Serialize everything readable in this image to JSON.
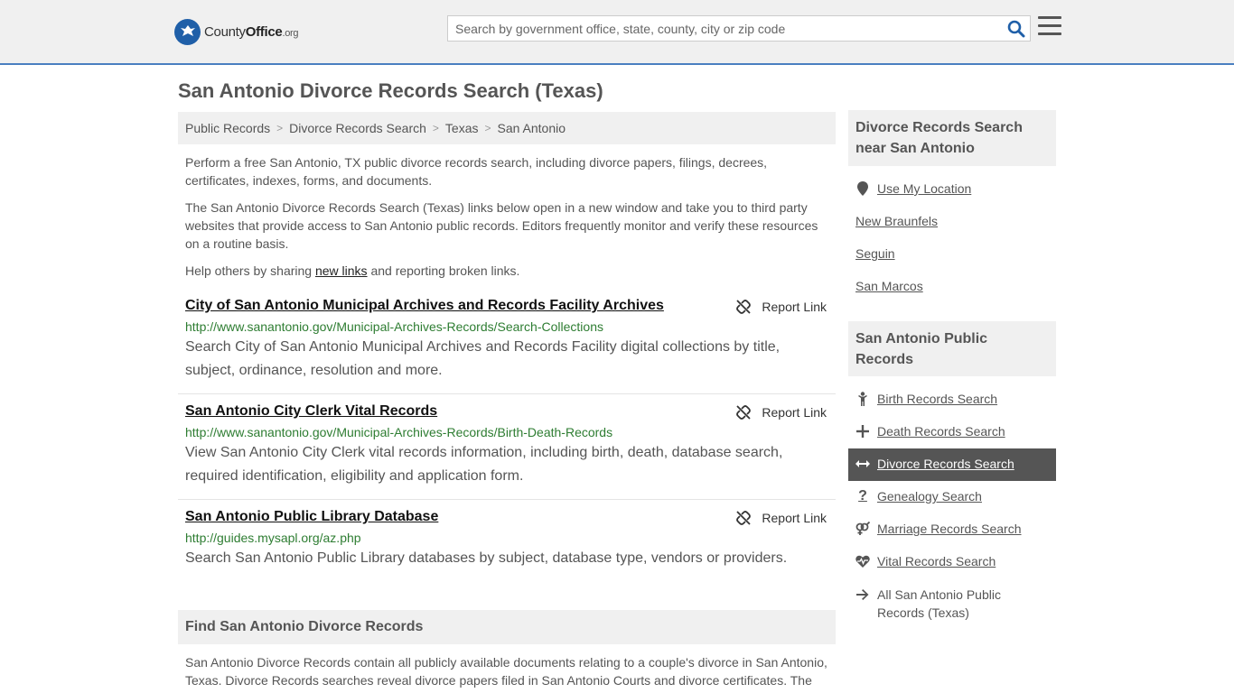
{
  "header": {
    "logo_main": "County",
    "logo_bold": "Office",
    "logo_suffix": ".org",
    "search_placeholder": "Search by government office, state, county, city or zip code"
  },
  "page_title": "San Antonio Divorce Records Search (Texas)",
  "breadcrumb": [
    "Public Records",
    "Divorce Records Search",
    "Texas",
    "San Antonio"
  ],
  "intro": {
    "p1": "Perform a free San Antonio, TX public divorce records search, including divorce papers, filings, decrees, certificates, indexes, forms, and documents.",
    "p2": "The San Antonio Divorce Records Search (Texas) links below open in a new window and take you to third party websites that provide access to San Antonio public records. Editors frequently monitor and verify these resources on a routine basis.",
    "p3_before": "Help others by sharing ",
    "p3_link": "new links",
    "p3_after": " and reporting broken links."
  },
  "report_label": "Report Link",
  "records": [
    {
      "title": "City of San Antonio Municipal Archives and Records Facility Archives",
      "url": "http://www.sanantonio.gov/Municipal-Archives-Records/Search-Collections",
      "desc": "Search City of San Antonio Municipal Archives and Records Facility digital collections by title, subject, ordinance, resolution and more."
    },
    {
      "title": "San Antonio City Clerk Vital Records",
      "url": "http://www.sanantonio.gov/Municipal-Archives-Records/Birth-Death-Records",
      "desc": "View San Antonio City Clerk vital records information, including birth, death, database search, required identification, eligibility and application form."
    },
    {
      "title": "San Antonio Public Library Database",
      "url": "http://guides.mysapl.org/az.php",
      "desc": "Search San Antonio Public Library databases by subject, database type, vendors or providers."
    }
  ],
  "find": {
    "heading": "Find San Antonio Divorce Records",
    "text": "San Antonio Divorce Records contain all publicly available documents relating to a couple's divorce in San Antonio, Texas. Divorce Records searches reveal divorce papers filed in San Antonio Courts and divorce certificates. The"
  },
  "sidebar": {
    "nearby_heading": "Divorce Records Search near San Antonio",
    "nearby": [
      "Use My Location",
      "New Braunfels",
      "Seguin",
      "San Marcos"
    ],
    "public_heading": "San Antonio Public Records",
    "public": [
      {
        "label": "Birth Records Search",
        "icon": "child-icon"
      },
      {
        "label": "Death Records Search",
        "icon": "cross-icon"
      },
      {
        "label": "Divorce Records Search",
        "icon": "arrows-horizontal-icon"
      },
      {
        "label": "Genealogy Search",
        "icon": "question-icon"
      },
      {
        "label": "Marriage Records Search",
        "icon": "venus-mars-icon"
      },
      {
        "label": "Vital Records Search",
        "icon": "heartbeat-icon"
      },
      {
        "label": "All San Antonio Public Records (Texas)",
        "icon": "arrow-right-icon"
      }
    ]
  },
  "colors": {
    "accent_border": "#4a7fc1",
    "url_green": "#2e7d32",
    "active_bg": "#555555",
    "logo_blue": "#1f5fa8"
  }
}
